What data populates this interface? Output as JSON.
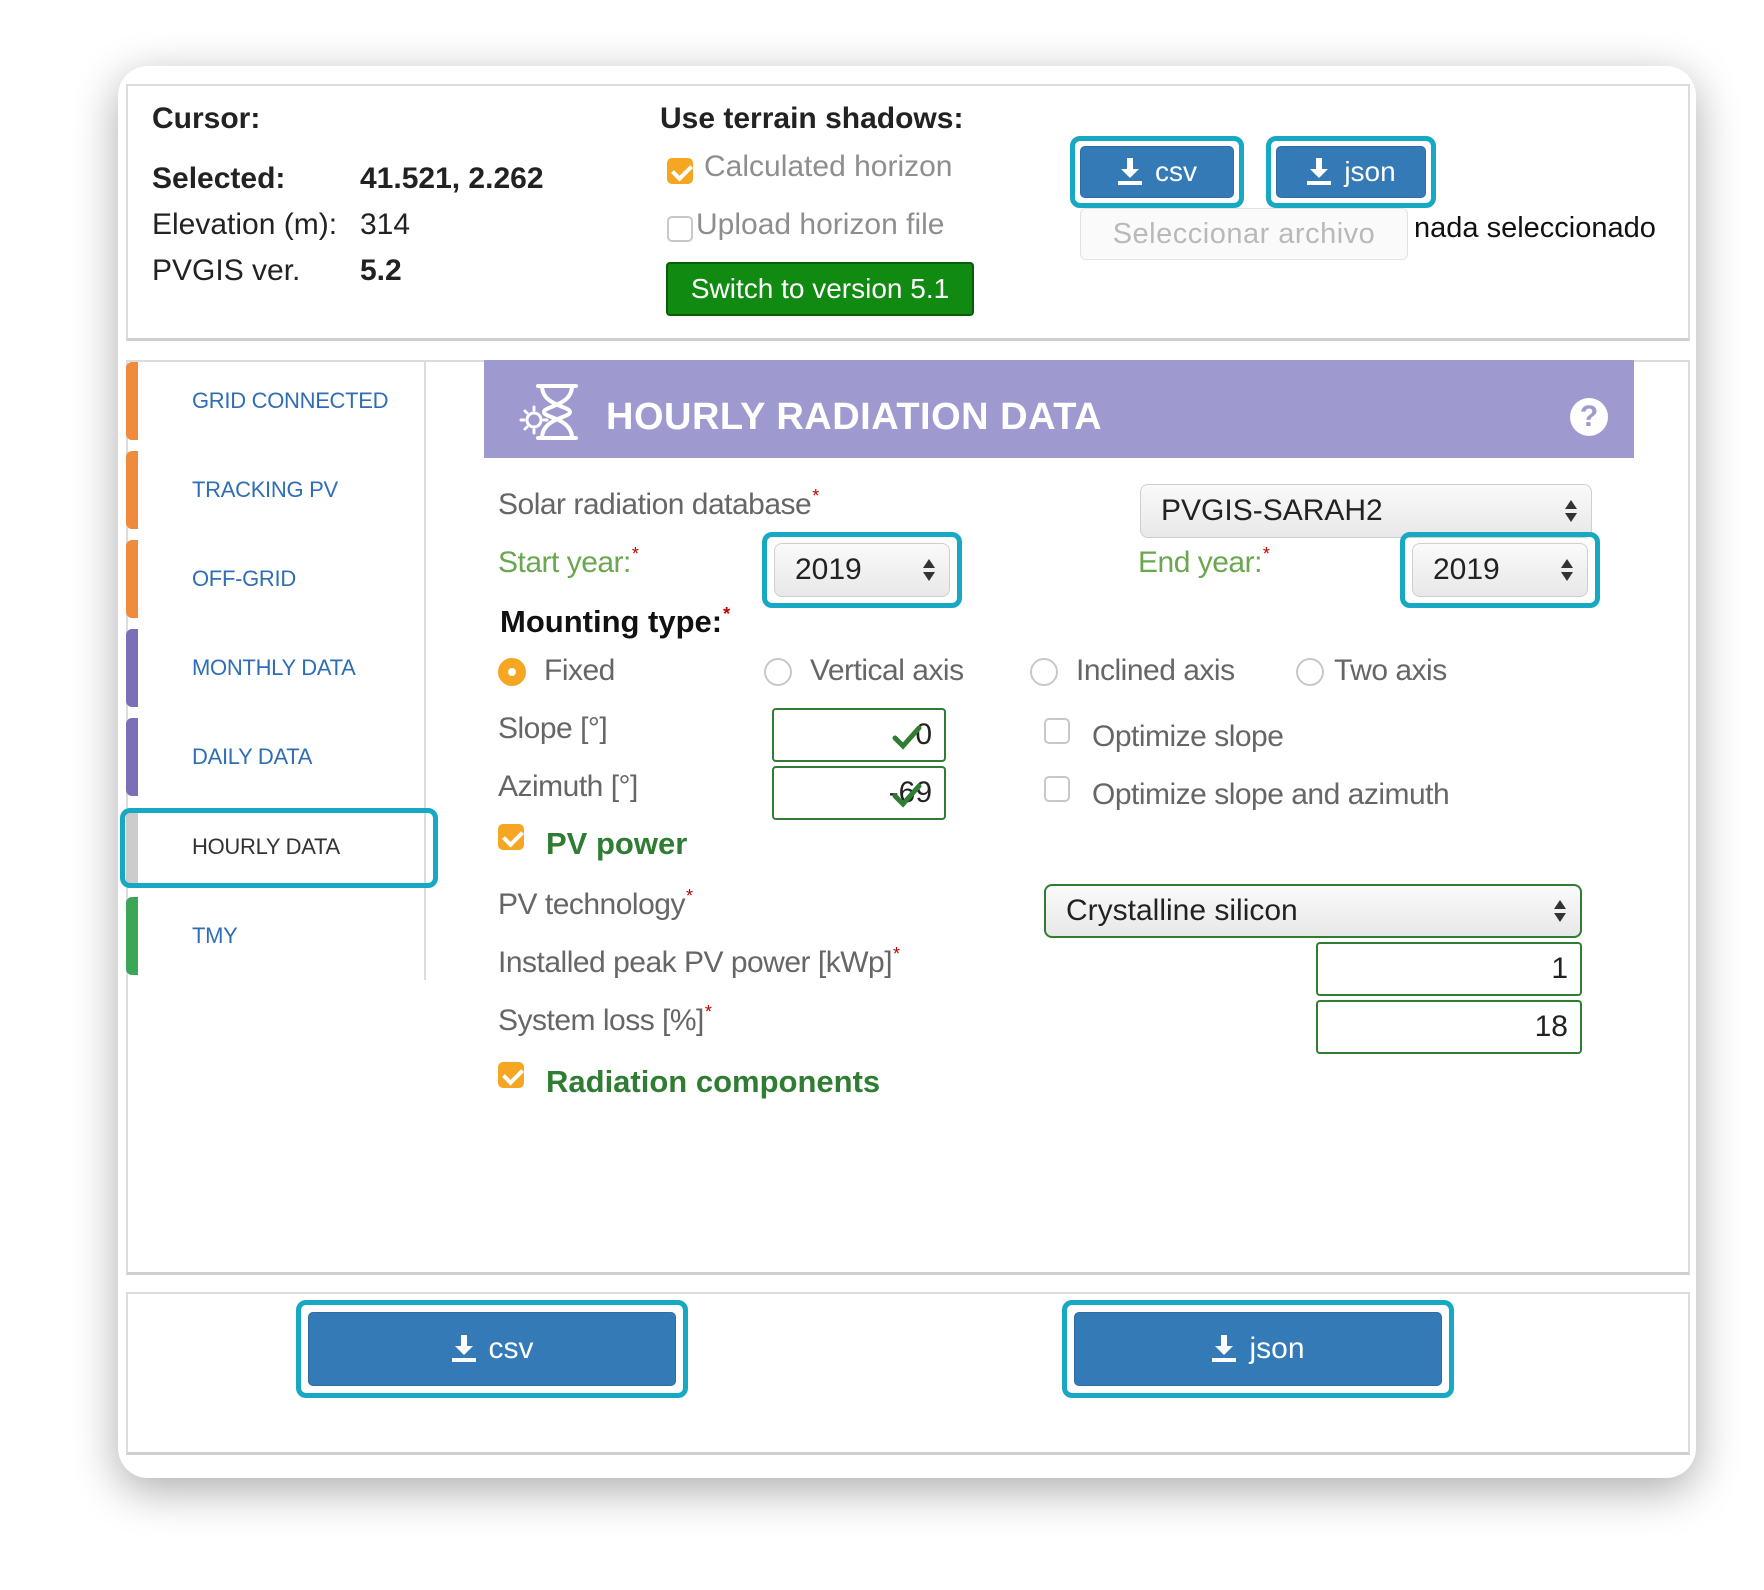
{
  "cursor": {
    "cursor_label": "Cursor:",
    "selected_label": "Selected:",
    "selected_value": "41.521, 2.262",
    "elevation_label": "Elevation (m):",
    "elevation_value": "314",
    "version_label": "PVGIS ver.",
    "version_value": "5.2"
  },
  "terrain": {
    "title": "Use terrain shadows:",
    "calculated_horizon": "Calculated horizon",
    "calculated_checked": true,
    "upload_horizon": "Upload horizon file",
    "upload_checked": false,
    "switch_button": "Switch to version 5.1"
  },
  "top_downloads": {
    "csv": "csv",
    "json": "json"
  },
  "file_input": {
    "button": "Seleccionar archivo",
    "status": "nada seleccionado"
  },
  "tabs": [
    {
      "label": "GRID CONNECTED",
      "color": "#f08a3c"
    },
    {
      "label": "TRACKING PV",
      "color": "#f08a3c"
    },
    {
      "label": "OFF-GRID",
      "color": "#f08a3c"
    },
    {
      "label": "MONTHLY DATA",
      "color": "#7b6fb8"
    },
    {
      "label": "DAILY DATA",
      "color": "#7b6fb8"
    },
    {
      "label": "HOURLY DATA",
      "color": "#cccccc"
    },
    {
      "label": "TMY",
      "color": "#3aa757"
    }
  ],
  "active_tab": "HOURLY DATA",
  "header": {
    "title": "HOURLY RADIATION DATA",
    "icon": "hourglass-sun-icon",
    "help_icon": "help-icon",
    "color": "#9e9ad0"
  },
  "form": {
    "database_label": "Solar radiation database",
    "database_value": "PVGIS-SARAH2",
    "start_year_label": "Start year:",
    "start_year_value": "2019",
    "end_year_label": "End year:",
    "end_year_value": "2019",
    "mounting_label": "Mounting type:",
    "mounting_options": [
      "Fixed",
      "Vertical axis",
      "Inclined axis",
      "Two axis"
    ],
    "mounting_selected": "Fixed",
    "slope_label": "Slope [°]",
    "slope_value": "0",
    "azimuth_label": "Azimuth [°]",
    "azimuth_value": "-69",
    "optimize_slope": "Optimize slope",
    "optimize_slope_azimuth": "Optimize slope and azimuth",
    "pv_power_label": "PV power",
    "pv_power_checked": true,
    "pv_technology_label": "PV technology",
    "pv_technology_value": "Crystalline silicon",
    "peak_power_label": "Installed peak PV power [kWp]",
    "peak_power_value": "1",
    "system_loss_label": "System loss [%]",
    "system_loss_value": "18",
    "radiation_components_label": "Radiation components",
    "radiation_components_checked": true,
    "required_mark": "*"
  },
  "bottom_downloads": {
    "csv": "csv",
    "json": "json"
  },
  "colors": {
    "accent_blue": "#337ab7",
    "highlight": "#17a9c4",
    "green_button": "#118a11",
    "checkbox_orange": "#f5a623",
    "label_green": "#2e7d32"
  }
}
